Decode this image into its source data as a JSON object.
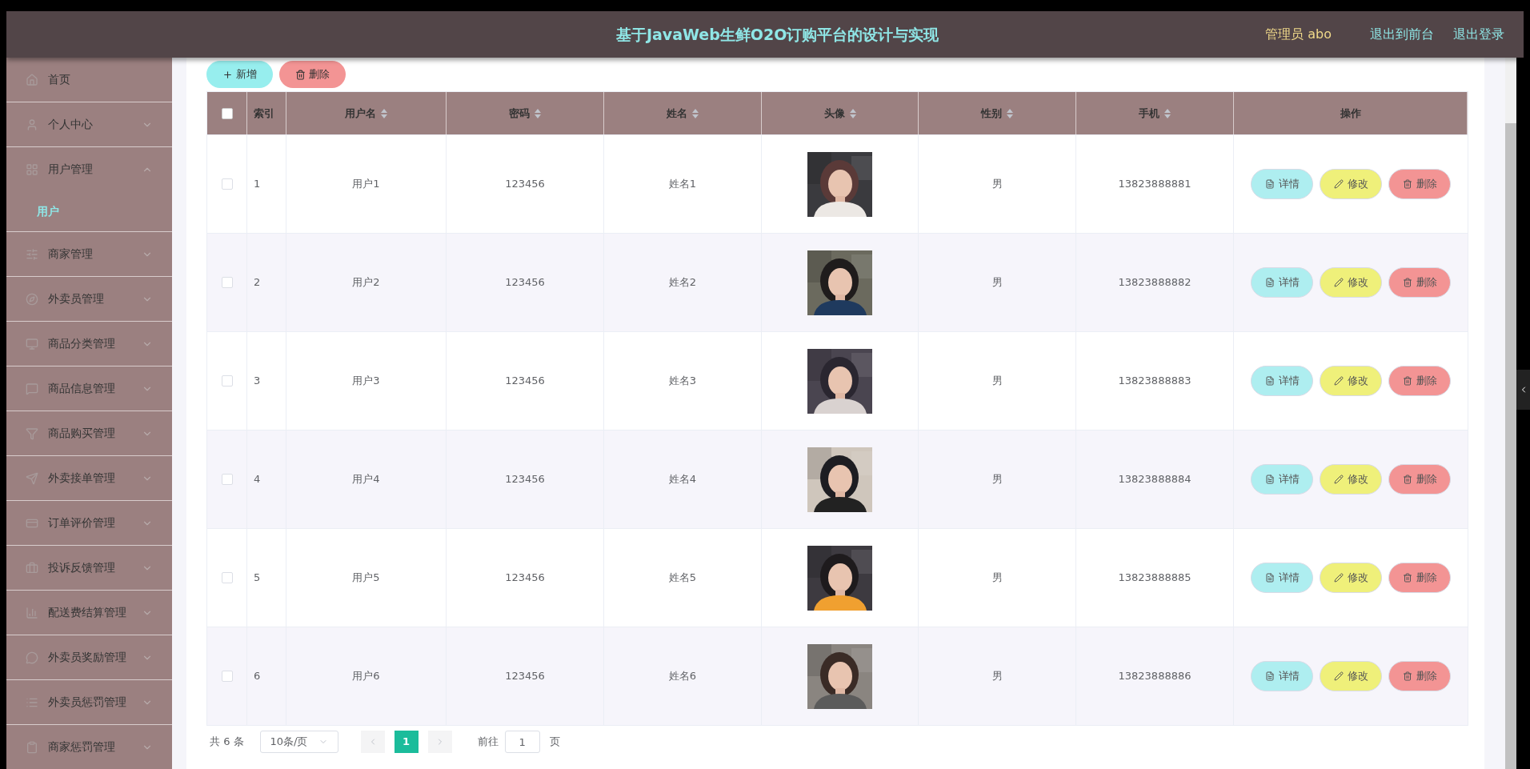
{
  "header": {
    "title": "基于JavaWeb生鲜O2O订购平台的设计与实现",
    "user": "管理员 abo",
    "links": [
      "退出到前台",
      "退出登录"
    ]
  },
  "sidebar": {
    "items": [
      {
        "label": "首页",
        "has_children": false
      },
      {
        "label": "个人中心",
        "has_children": true,
        "expanded": false
      },
      {
        "label": "用户管理",
        "has_children": true,
        "expanded": true,
        "children": [
          {
            "label": "用户",
            "selected": true
          }
        ]
      },
      {
        "label": "商家管理",
        "has_children": true,
        "expanded": false
      },
      {
        "label": "外卖员管理",
        "has_children": true,
        "expanded": false
      },
      {
        "label": "商品分类管理",
        "has_children": true,
        "expanded": false
      },
      {
        "label": "商品信息管理",
        "has_children": true,
        "expanded": false
      },
      {
        "label": "商品购买管理",
        "has_children": true,
        "expanded": false
      },
      {
        "label": "外卖接单管理",
        "has_children": true,
        "expanded": false
      },
      {
        "label": "订单评价管理",
        "has_children": true,
        "expanded": false
      },
      {
        "label": "投诉反馈管理",
        "has_children": true,
        "expanded": false
      },
      {
        "label": "配送费结算管理",
        "has_children": true,
        "expanded": false
      },
      {
        "label": "外卖员奖励管理",
        "has_children": true,
        "expanded": false
      },
      {
        "label": "外卖员惩罚管理",
        "has_children": true,
        "expanded": false
      },
      {
        "label": "商家惩罚管理",
        "has_children": true,
        "expanded": false
      }
    ]
  },
  "toolbar": [
    {
      "label": "新增",
      "kind": "add"
    },
    {
      "label": "删除",
      "kind": "delete"
    }
  ],
  "table": {
    "select_all_checked": false,
    "columns": [
      {
        "label": "索引",
        "sortable": false
      },
      {
        "label": "用户名",
        "sortable": true
      },
      {
        "label": "密码",
        "sortable": true
      },
      {
        "label": "姓名",
        "sortable": true
      },
      {
        "label": "头像",
        "sortable": true
      },
      {
        "label": "性别",
        "sortable": true
      },
      {
        "label": "手机",
        "sortable": true
      },
      {
        "label": "操作",
        "sortable": false
      }
    ],
    "rows": [
      {
        "checked": false,
        "index": "1",
        "username": "用户1",
        "password": "123456",
        "name": "姓名1",
        "gender": "男",
        "phone": "13823888881",
        "actions": [
          {
            "label": "详情",
            "kind": "detail"
          },
          {
            "label": "修改",
            "kind": "edit"
          },
          {
            "label": "删除",
            "kind": "delete"
          }
        ]
      },
      {
        "checked": false,
        "index": "2",
        "username": "用户2",
        "password": "123456",
        "name": "姓名2",
        "gender": "男",
        "phone": "13823888882",
        "actions": [
          {
            "label": "详情",
            "kind": "detail"
          },
          {
            "label": "修改",
            "kind": "edit"
          },
          {
            "label": "删除",
            "kind": "delete"
          }
        ]
      },
      {
        "checked": false,
        "index": "3",
        "username": "用户3",
        "password": "123456",
        "name": "姓名3",
        "gender": "男",
        "phone": "13823888883",
        "actions": [
          {
            "label": "详情",
            "kind": "detail"
          },
          {
            "label": "修改",
            "kind": "edit"
          },
          {
            "label": "删除",
            "kind": "delete"
          }
        ]
      },
      {
        "checked": false,
        "index": "4",
        "username": "用户4",
        "password": "123456",
        "name": "姓名4",
        "gender": "男",
        "phone": "13823888884",
        "actions": [
          {
            "label": "详情",
            "kind": "detail"
          },
          {
            "label": "修改",
            "kind": "edit"
          },
          {
            "label": "删除",
            "kind": "delete"
          }
        ]
      },
      {
        "checked": false,
        "index": "5",
        "username": "用户5",
        "password": "123456",
        "name": "姓名5",
        "gender": "男",
        "phone": "13823888885",
        "actions": [
          {
            "label": "详情",
            "kind": "detail"
          },
          {
            "label": "修改",
            "kind": "edit"
          },
          {
            "label": "删除",
            "kind": "delete"
          }
        ]
      },
      {
        "checked": false,
        "index": "6",
        "username": "用户6",
        "password": "123456",
        "name": "姓名6",
        "gender": "男",
        "phone": "13823888886",
        "actions": [
          {
            "label": "详情",
            "kind": "detail"
          },
          {
            "label": "修改",
            "kind": "edit"
          },
          {
            "label": "删除",
            "kind": "delete"
          }
        ]
      }
    ]
  },
  "pagination": {
    "total": "共 6 条",
    "page_size": "10条/页",
    "pages": [
      {
        "label": "1",
        "selected": true
      }
    ],
    "goto_label": "前往",
    "goto_value": "1",
    "goto_suffix": "页"
  }
}
